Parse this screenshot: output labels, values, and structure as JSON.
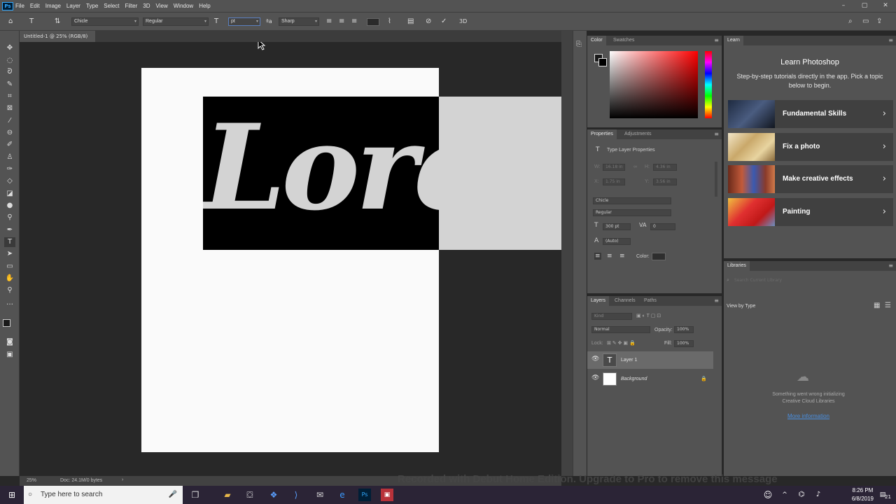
{
  "menubar": {
    "logo": "Ps",
    "items": [
      "File",
      "Edit",
      "Image",
      "Layer",
      "Type",
      "Select",
      "Filter",
      "3D",
      "View",
      "Window",
      "Help"
    ],
    "window_controls": [
      "–",
      "▢",
      "✕"
    ]
  },
  "options": {
    "font_family": "Chicle",
    "font_style": "Regular",
    "font_size": "pt",
    "anti_alias": "Sharp"
  },
  "document": {
    "tab_label": "Untitled-1 @ 25% (RGB/8)",
    "tab_close": "×",
    "text_content": "Lorem",
    "colors": {
      "text_fill": "#d3d3d3",
      "text_bg": "#000000",
      "canvas": "#fafafa"
    }
  },
  "status": {
    "doc_info": "Doc: 24.1M/0 bytes",
    "zoom": "25%"
  },
  "color_panel": {
    "tabs": [
      "Color",
      "Swatches"
    ]
  },
  "properties_panel": {
    "tabs": [
      "Properties",
      "Adjustments"
    ],
    "title": "Type Layer Properties",
    "w": "W:",
    "w_val": "16.18 in",
    "h": "H:",
    "h_val": "4.36 in",
    "x": "X:",
    "x_val": "1.75 in",
    "y": "Y:",
    "y_val": "3.56 in",
    "font_family": "Chicle",
    "font_style": "Regular",
    "font_size": "300 pt",
    "tracking": "0",
    "leading": "(Auto)",
    "color_label": "Color:"
  },
  "layers_panel": {
    "tabs": [
      "Layers",
      "Channels",
      "Paths"
    ],
    "kind": "Kind",
    "blend_mode": "Normal",
    "opacity_label": "Opacity:",
    "opacity": "100%",
    "lock_label": "Lock:",
    "fill_label": "Fill:",
    "fill": "100%",
    "layers": [
      {
        "name": "Layer 1",
        "type": "text"
      },
      {
        "name": "Background",
        "type": "fill"
      }
    ]
  },
  "learn_panel": {
    "tab": "Learn",
    "title": "Learn Photoshop",
    "subtitle": "Step-by-step tutorials directly in the app. Pick a topic below to begin.",
    "cards": [
      {
        "label": "Fundamental Skills"
      },
      {
        "label": "Fix a photo"
      },
      {
        "label": "Make creative effects"
      },
      {
        "label": "Painting"
      }
    ]
  },
  "libraries_panel": {
    "tab": "Libraries",
    "search_placeholder": "Search Current Library",
    "view_by": "View by Type",
    "error": "Something went wrong initializing Creative Cloud Libraries",
    "link": "More information"
  },
  "taskbar": {
    "search_placeholder": "Type here to search",
    "time": "8:26 PM",
    "date": "6/8/2019",
    "notif_count": "21"
  },
  "watermark": "Recorded with Debut Home Edition. Upgrade to Pro to remove this message"
}
